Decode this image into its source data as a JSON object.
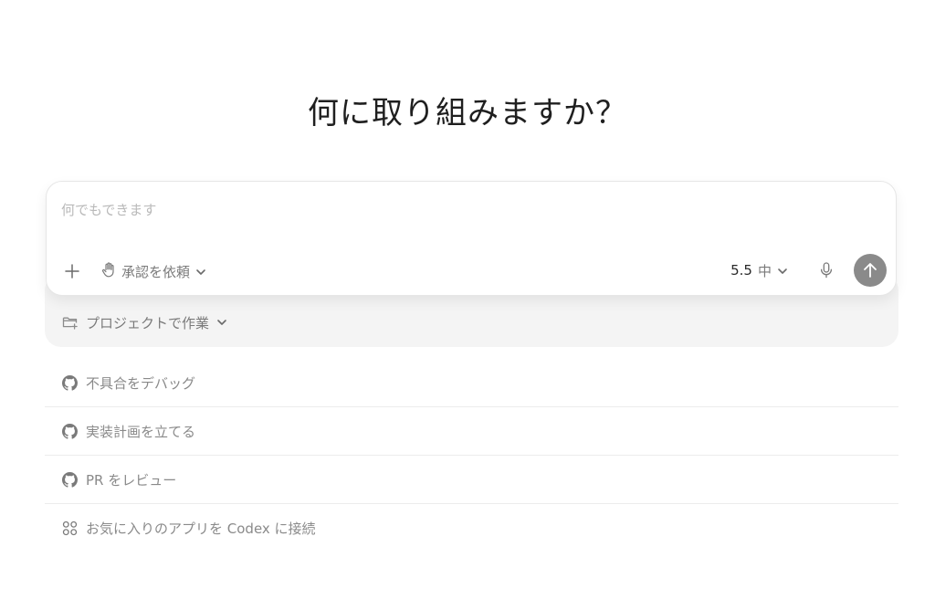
{
  "heading": "何に取り組みますか？",
  "composer": {
    "placeholder": "何でもできます",
    "approval_label": "承認を依頼",
    "model_version": "5.5",
    "effort_level": "中"
  },
  "project": {
    "label": "プロジェクトで作業"
  },
  "suggestions": [
    {
      "icon": "github-icon",
      "label": "不具合をデバッグ"
    },
    {
      "icon": "github-icon",
      "label": "実装計画を立てる"
    },
    {
      "icon": "github-icon",
      "label": "PR をレビュー"
    },
    {
      "icon": "apps-grid-icon",
      "label": "お気に入りのアプリを Codex に接続"
    }
  ],
  "colors": {
    "send_button": "#8a8a8a",
    "tray": "#f4f4f4",
    "muted_text": "#7a7a7a"
  }
}
